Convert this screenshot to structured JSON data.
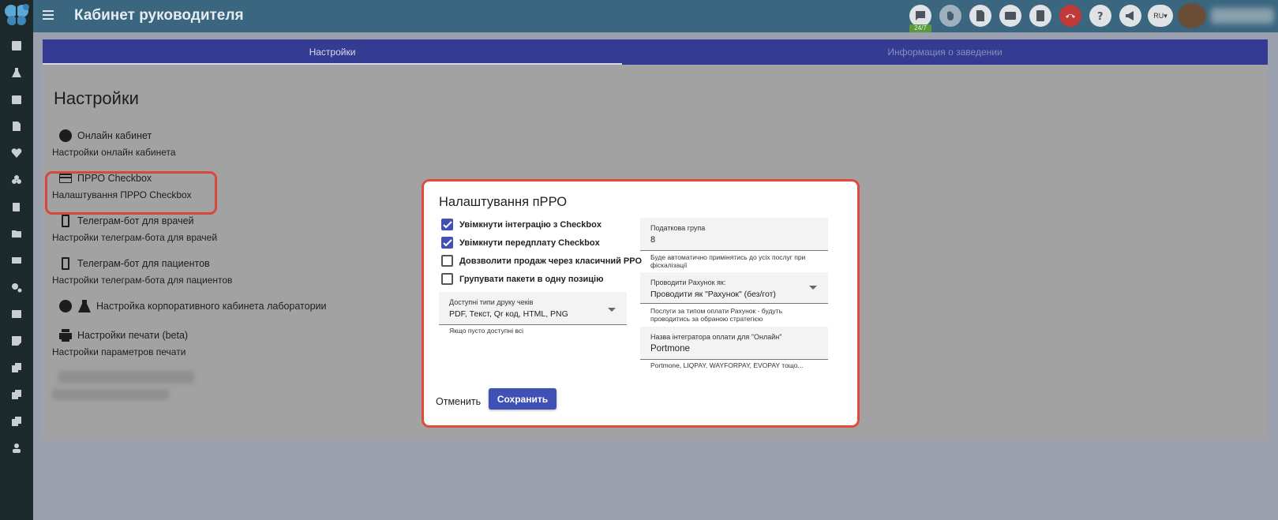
{
  "app": {
    "title": "Кабинет руководителя"
  },
  "topbar": {
    "support_badge": "24/7",
    "lang": "RU",
    "accent": "#3a6680"
  },
  "tabs": [
    {
      "label": "Настройки",
      "active": true
    },
    {
      "label": "Информация о заведении",
      "active": false
    }
  ],
  "page": {
    "title": "Настройки",
    "items": [
      {
        "title": "Онлайн кабинет",
        "subtitle": "Настройки онлайн кабинета",
        "icon": "globe-icon"
      },
      {
        "title": "ПРРО Checkbox",
        "subtitle": "Налаштування ПРРО Checkbox",
        "icon": "credit-card-icon"
      },
      {
        "title": "Телеграм-бот для врачей",
        "subtitle": "Настройки телеграм-бота для врачей",
        "icon": "phone-touch-icon"
      },
      {
        "title": "Телеграм-бот для пациентов",
        "subtitle": "Настройки телеграм-бота для пациентов",
        "icon": "phone-touch-icon"
      },
      {
        "title": "Настройка корпоративного кабинета лаборатории",
        "subtitle": "",
        "icon": "flask-icon"
      },
      {
        "title": "Настройки печати (beta)",
        "subtitle": "Настройки параметров печати",
        "icon": "printer-icon"
      }
    ]
  },
  "modal": {
    "title": "Налаштування пРРО",
    "checkboxes": [
      {
        "label": "Увімкнути інтеграцію з Checkbox",
        "checked": true
      },
      {
        "label": "Увімкнути передплату Checkbox",
        "checked": true
      },
      {
        "label": "Довзволити продаж через класичний РРО",
        "checked": false
      },
      {
        "label": "Групувати пакети в одну позицію",
        "checked": false
      }
    ],
    "print_types": {
      "label": "Доступні типи друку чеків",
      "value": "PDF, Текст, Qr код, HTML, PNG",
      "helper": "Якщо пусто доступні всі"
    },
    "tax_group": {
      "label": "Податкова група",
      "value": "8",
      "helper": "Буде автоматично примінятись до усіх послуг при фіскалізації"
    },
    "invoice_mode": {
      "label": "Проводити Рахунок як:",
      "value": "Проводити як \"Рахунок\" (без/гот)",
      "helper": "Послуги за типом оплати Рахунок - будуть проводитись за обраною стратегією"
    },
    "integrator": {
      "label": "Назва інтегратора оплати для \"Онлайн\"",
      "value": "Portmone",
      "helper": "Portmone, LIQPAY, WAYFORPAY, EVOPAY тощо..."
    },
    "cancel_label": "Отменить",
    "save_label": "Сохранить",
    "accent": "#3f51b5",
    "highlight_color": "#e14b3c"
  }
}
